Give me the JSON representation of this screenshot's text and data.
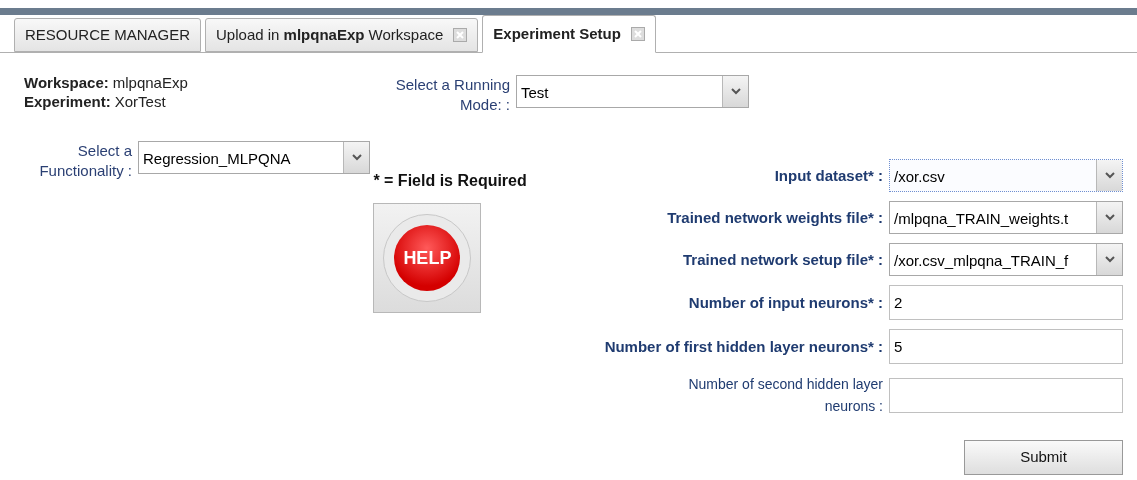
{
  "tabs": [
    {
      "label": "RESOURCE MANAGER",
      "selected": false,
      "closable": false
    },
    {
      "label": "Upload in **mlpqnaExp** Workspace",
      "selected": false,
      "closable": true
    },
    {
      "label": "Experiment Setup",
      "selected": true,
      "closable": true
    }
  ],
  "info": [
    {
      "label": "Workspace:",
      "value": "mlpqnaExp"
    },
    {
      "label": "Experiment:",
      "value": "XorTest"
    }
  ],
  "running_mode": {
    "label": "Select a Running Mode: :",
    "value": "Test"
  },
  "functionality": {
    "label": "Select a Functionality :",
    "value": "Regression_MLPQNA"
  },
  "required_note": "* = Field is Required",
  "help_button": "HELP",
  "fields": [
    {
      "label": "Input dataset* :",
      "kind": "select",
      "value": "/xor.csv",
      "required": true,
      "focused": true
    },
    {
      "label": "Trained network weights file* :",
      "kind": "select",
      "value": "/mlpqna_TRAIN_weights.t",
      "required": true,
      "focused": false
    },
    {
      "label": "Trained network setup file* :",
      "kind": "select",
      "value": "/xor.csv_mlpqna_TRAIN_f",
      "required": true,
      "focused": false
    },
    {
      "label": "Number of input neurons* :",
      "kind": "text",
      "value": "2",
      "required": true,
      "focused": false
    },
    {
      "label": "Number of first hidden layer neurons* :",
      "kind": "text",
      "value": "5",
      "required": true,
      "focused": false
    },
    {
      "label": "Number of second hidden layer neurons :",
      "kind": "text",
      "required": false,
      "focused": false
    }
  ],
  "submit_button": "Submit"
}
